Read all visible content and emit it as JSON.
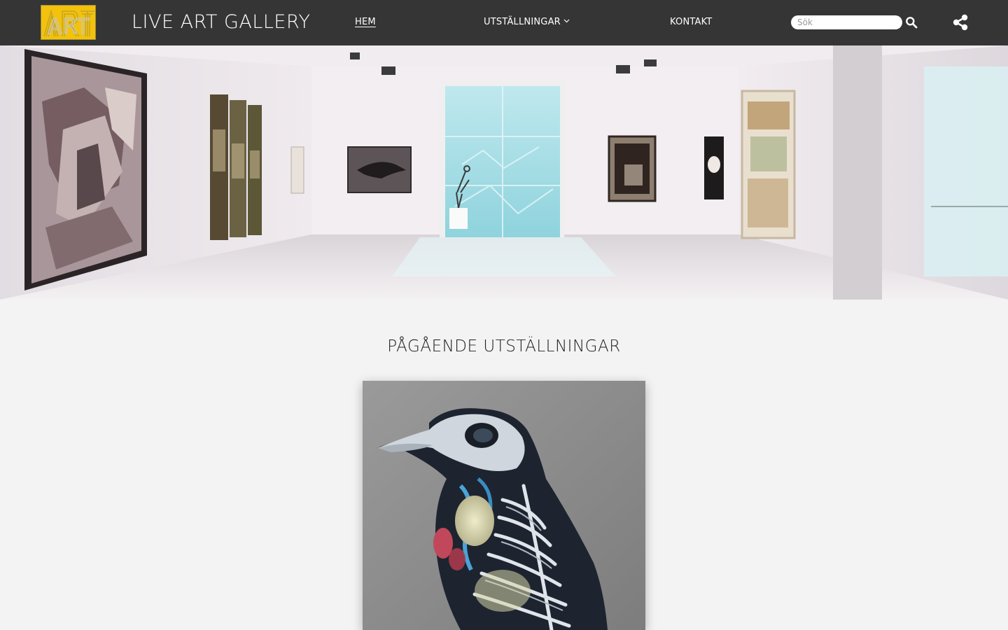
{
  "header": {
    "logo_text": "ART",
    "site_title": "LIVE ART GALLERY",
    "nav": {
      "home": "HEM",
      "exhibitions": "UTSTÄLLNINGAR",
      "contact": "KONTAKT"
    },
    "search": {
      "placeholder": "Sök",
      "value": ""
    },
    "icons": {
      "search": "search-icon",
      "share": "share-icon",
      "dropdown": "chevron-down-icon"
    }
  },
  "hero": {
    "image": "gallery-interior-photo"
  },
  "main": {
    "section_title": "PÅGÅENDE UTSTÄLLNINGAR",
    "featured_card": {
      "image": "anatomical-bird-painting"
    }
  },
  "colors": {
    "header_bg": "#353535",
    "page_bg": "#f3f3f3",
    "logo_bg": "#f2c20d",
    "text_light": "#ffffff"
  }
}
